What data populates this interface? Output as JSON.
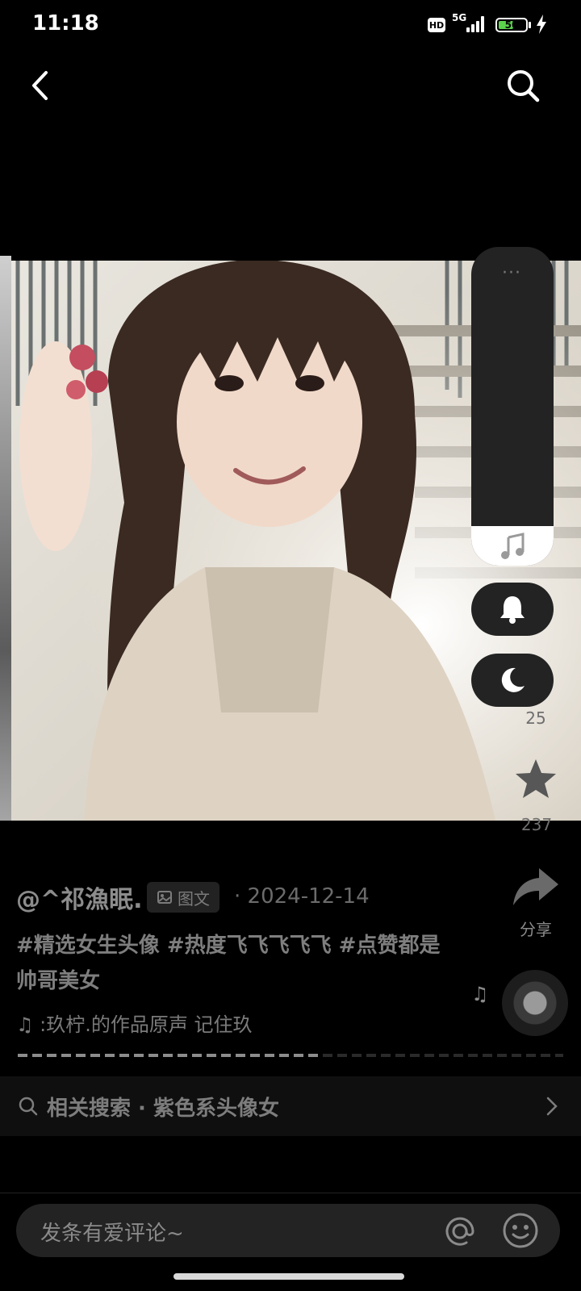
{
  "status_bar": {
    "time": "11:18",
    "hd": "HD",
    "network": "5G",
    "battery": "50",
    "battery_level": 0.5
  },
  "top_nav": {
    "back_icon": "chevron-left-icon",
    "search_icon": "search-icon"
  },
  "side_panel": {
    "more": "···",
    "music_icon": "music-note-icon",
    "bell_icon": "bell-icon",
    "moon_icon": "moon-icon"
  },
  "side_actions": {
    "count_1": "25",
    "count_2": "237",
    "share_label": "分享",
    "star_icon": "star-icon",
    "share_icon": "share-arrow-icon"
  },
  "post": {
    "author": "@^祁漁眠.",
    "type_label": "图文",
    "date": "· 2024-12-14",
    "caption": "#精选女生头像 #热度飞飞飞飞飞 #点赞都是帅哥美女",
    "sound": ":玖柠.的作品原声     记住玖"
  },
  "related_search": {
    "label": "相关搜索 · 紫色系头像女"
  },
  "comment": {
    "placeholder": "发条有爱评论~",
    "mention_icon": "at-icon",
    "emoji_icon": "smile-icon"
  },
  "colors": {
    "background": "#000000",
    "panel": "#232323",
    "battery_fill": "#5bd34c"
  }
}
